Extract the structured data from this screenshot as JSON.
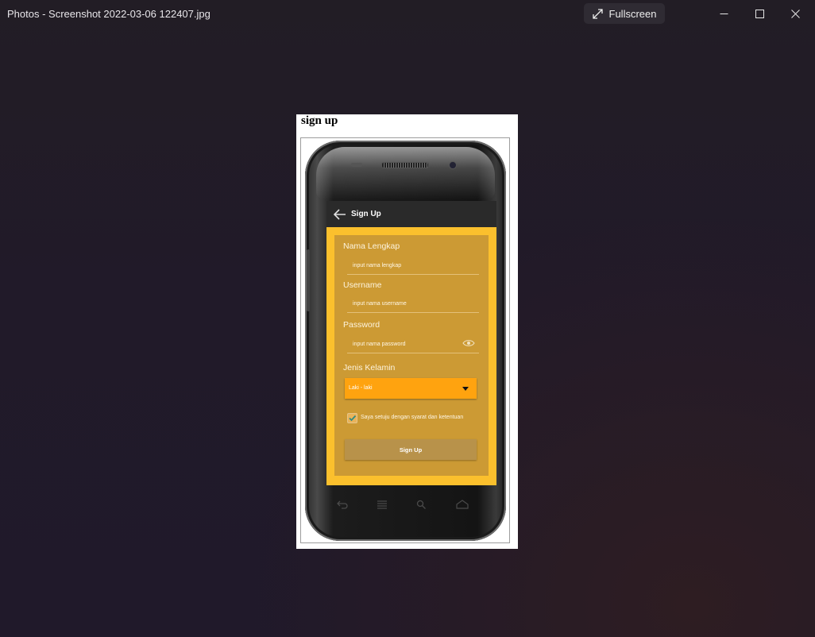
{
  "window": {
    "title": "Photos - Screenshot 2022-03-06 122407.jpg",
    "fullscreen_label": "Fullscreen"
  },
  "document": {
    "heading": "sign up"
  },
  "app": {
    "appbar_title": "Sign Up",
    "form": {
      "full_name_label": "Nama Lengkap",
      "full_name_placeholder": "input nama lengkap",
      "username_label": "Username",
      "username_placeholder": "input nama username",
      "password_label": "Password",
      "password_placeholder": "input nama password",
      "gender_label": "Jenis Kelamin",
      "gender_selected": "Laki - laki",
      "agree_label": "Saya setuju dengan syarat dan ketentuan",
      "agree_checked": true,
      "submit_label": "Sign Up"
    }
  },
  "colors": {
    "accent_yellow": "#fbc02d",
    "form_background": "#cc9a34",
    "dropdown": "#ffa30f",
    "button": "#b8924a"
  }
}
